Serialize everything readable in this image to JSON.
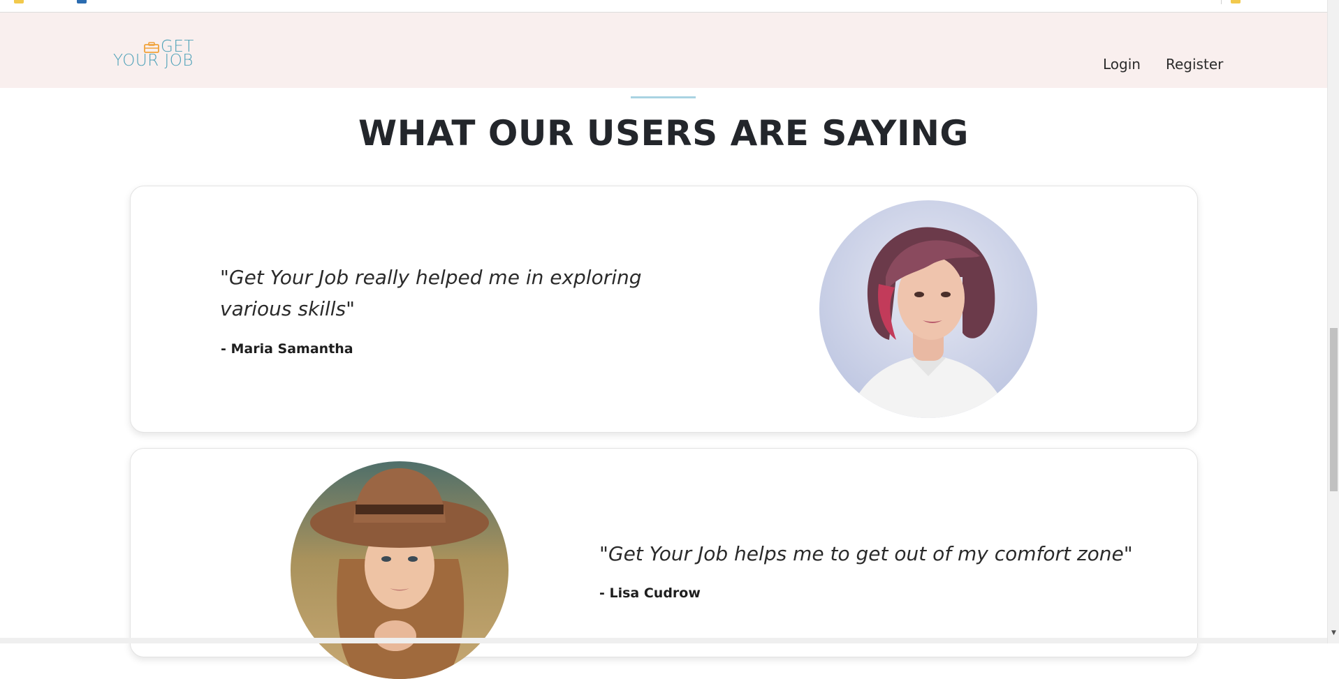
{
  "navbar": {
    "logo": {
      "line1": "GET",
      "line2": "YOUR JOB"
    },
    "links": {
      "login": "Login",
      "register": "Register"
    }
  },
  "section": {
    "title": "WHAT OUR USERS ARE SAYING"
  },
  "testimonials": [
    {
      "quote": "\"Get Your Job really helped me in exploring various skills\"",
      "author": "- Maria Samantha"
    },
    {
      "quote": "\"Get Your Job helps me to get out of my comfort zone\"",
      "author": "- Lisa Cudrow"
    }
  ],
  "colors": {
    "navbar_bg": "#f9efee",
    "logo_text": "#4ea1b8",
    "logo_briefcase": "#f0a23b",
    "title_accent": "#a9d3e2"
  },
  "scrollbar": {
    "position_fraction": 0.51
  }
}
